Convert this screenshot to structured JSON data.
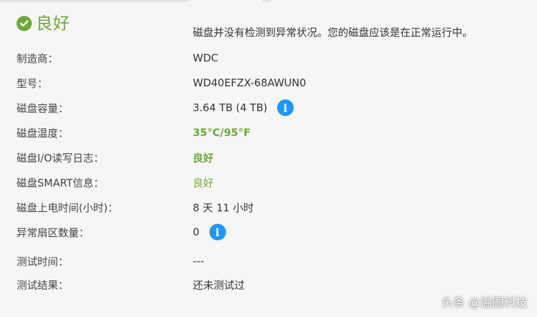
{
  "status": {
    "title": "良好",
    "summary": "磁盘并没有检测到异常状况。您的磁盘应该是在正常运行中。"
  },
  "details": {
    "manufacturer_label": "制造商：",
    "manufacturer_value": "WDC",
    "model_label": "型号：",
    "model_value": "WD40EFZX-68AWUN0",
    "capacity_label": "磁盘容量：",
    "capacity_value": "3.64 TB (4 TB)",
    "temperature_label": "磁盘温度：",
    "temperature_value": "35°C/95°F",
    "io_log_label": "磁盘I/O读写日志：",
    "io_log_value": "良好",
    "smart_label": "磁盘SMART信息：",
    "smart_value": "良好",
    "power_on_label": "磁盘上电时间(小时)：",
    "power_on_value": "8 天 11 小时",
    "bad_sectors_label": "异常扇区数量：",
    "bad_sectors_value": "0",
    "test_time_label": "测试时间：",
    "test_time_value": "---",
    "test_result_label": "测试结果：",
    "test_result_value": "还未测试过"
  },
  "watermark": "头条 @溢图科技",
  "icons": {
    "status": "check-circle-icon",
    "info": "info-icon"
  },
  "colors": {
    "success": "#6ea83a",
    "info": "#2196f3"
  }
}
